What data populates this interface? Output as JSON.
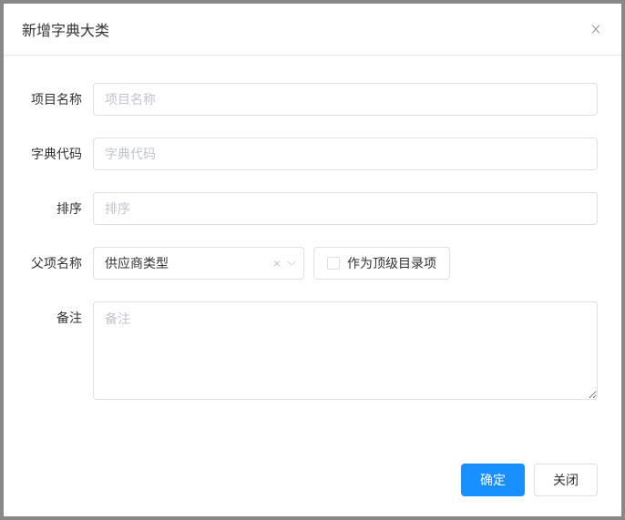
{
  "modal": {
    "title": "新增字典大类"
  },
  "form": {
    "projectName": {
      "label": "项目名称",
      "placeholder": "项目名称",
      "value": ""
    },
    "dictCode": {
      "label": "字典代码",
      "placeholder": "字典代码",
      "value": ""
    },
    "sort": {
      "label": "排序",
      "placeholder": "排序",
      "value": ""
    },
    "parentName": {
      "label": "父项名称",
      "selected": "供应商类型",
      "checkboxLabel": "作为顶级目录项",
      "checked": false
    },
    "remark": {
      "label": "备注",
      "placeholder": "备注",
      "value": ""
    }
  },
  "footer": {
    "confirm": "确定",
    "cancel": "关闭"
  }
}
